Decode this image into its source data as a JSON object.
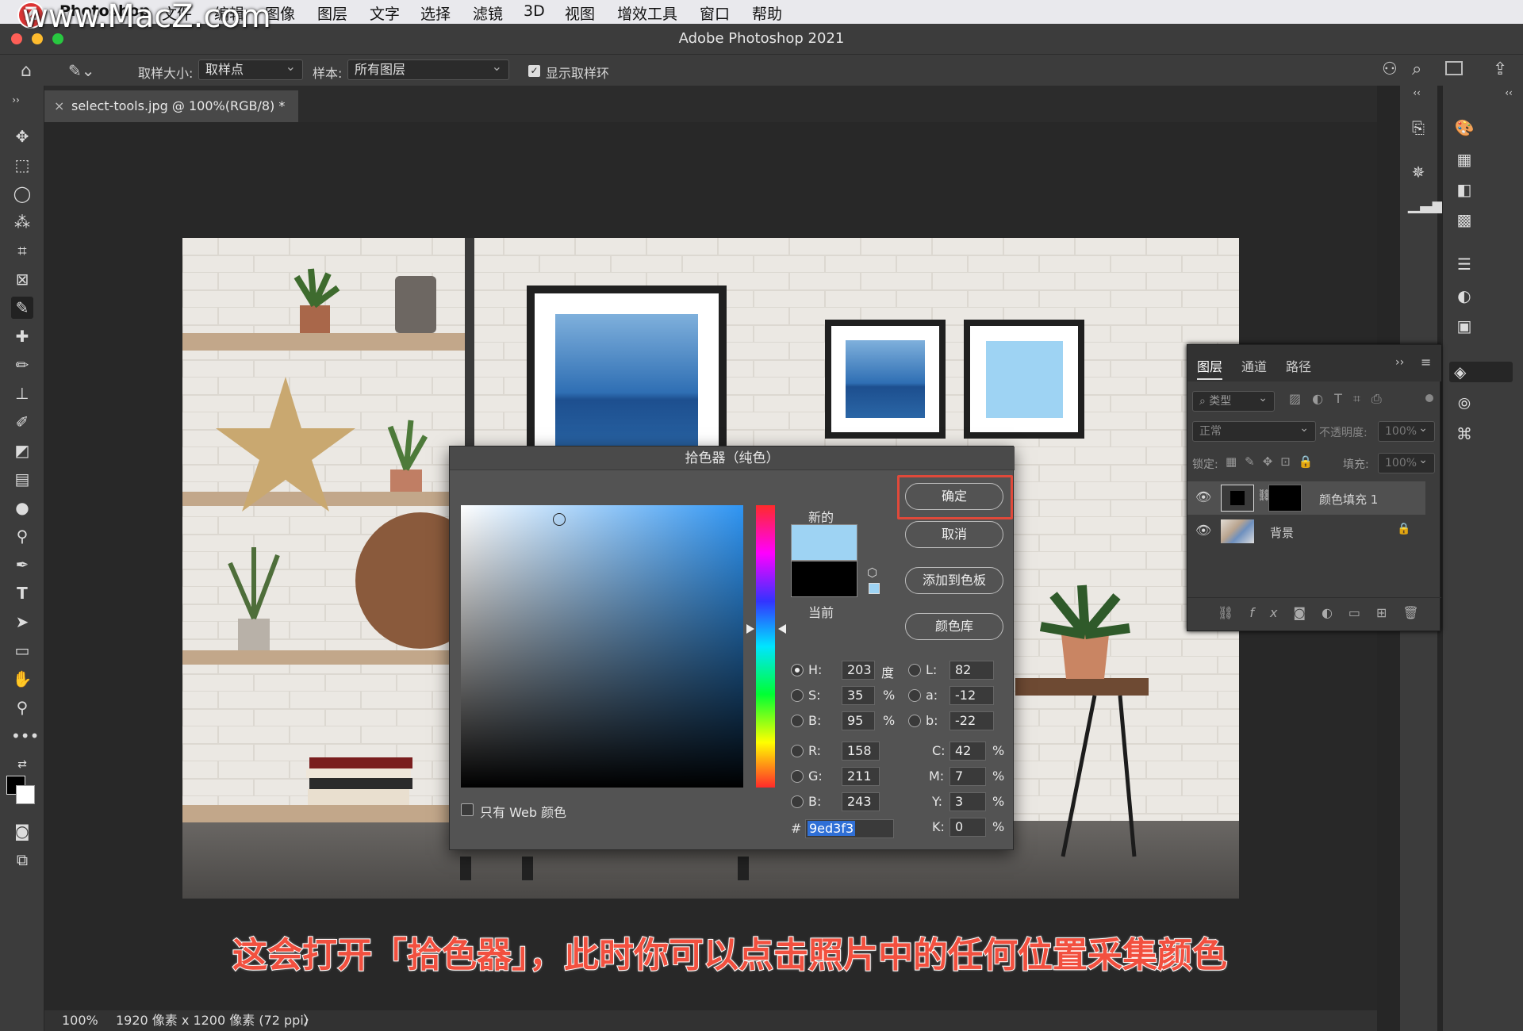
{
  "watermark": {
    "site": "www.MacZ.com",
    "logo_letter": "Z"
  },
  "menubar": {
    "app": "Photoshop",
    "items": [
      "文件",
      "编辑",
      "图像",
      "图层",
      "文字",
      "选择",
      "滤镜",
      "3D",
      "视图",
      "增效工具",
      "窗口",
      "帮助"
    ]
  },
  "window": {
    "title": "Adobe Photoshop 2021"
  },
  "options": {
    "sample_size_label": "取样大小:",
    "sample_size_value": "取样点",
    "sample_label": "样本:",
    "sample_value": "所有图层",
    "show_ring_label": "显示取样环"
  },
  "document": {
    "tab_title": "select-tools.jpg @ 100%(RGB/8) *",
    "close": "×"
  },
  "status": {
    "zoom": "100%",
    "info": "1920 像素 x 1200 像素 (72 ppi)",
    "arrow": "〉"
  },
  "layers_panel": {
    "tabs": [
      "图层",
      "通道",
      "路径"
    ],
    "filter_label": "类型",
    "blend_mode": "正常",
    "opacity_label": "不透明度:",
    "opacity_value": "100%",
    "lock_label": "锁定:",
    "fill_label": "填充:",
    "fill_value": "100%",
    "layers": [
      {
        "name": "颜色填充 1"
      },
      {
        "name": "背景"
      }
    ],
    "bottom_fx": "fx"
  },
  "color_picker": {
    "title": "拾色器（纯色）",
    "new_label": "新的",
    "current_label": "当前",
    "new_color": "#9ed3f3",
    "current_color": "#000000",
    "buttons": {
      "ok": "确定",
      "cancel": "取消",
      "add_swatch": "添加到色板",
      "libraries": "颜色库"
    },
    "web_only_label": "只有 Web 颜色",
    "hsb": {
      "h": "203",
      "s": "35",
      "b": "95",
      "h_unit": "度",
      "s_unit": "%",
      "b_unit": "%"
    },
    "lab": {
      "l": "82",
      "a": "-12",
      "b": "-22"
    },
    "rgb": {
      "r": "158",
      "g": "211",
      "b": "243"
    },
    "cmyk": {
      "c": "42",
      "m": "7",
      "y": "3",
      "k": "0"
    },
    "hex": "9ed3f3",
    "labels": {
      "h": "H:",
      "s": "S:",
      "b": "B:",
      "l": "L:",
      "la": "a:",
      "lb": "b:",
      "r": "R:",
      "g": "G:",
      "rb": "B:",
      "c": "C:",
      "m": "M:",
      "y": "Y:",
      "k": "K:",
      "hash": "#",
      "pct": "%"
    }
  },
  "caption": "这会打开「拾色器」，此时你可以点击照片中的任何位置采集颜色",
  "colors": {
    "highlight": "#e0493a",
    "selected_hex_bg": "#2f6fd6"
  }
}
